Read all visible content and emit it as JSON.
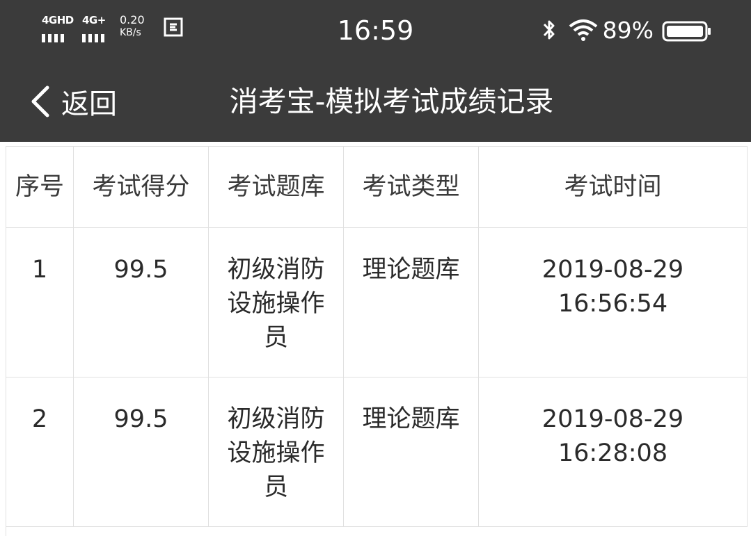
{
  "status": {
    "net1": "4GHD",
    "net2": "4G+",
    "speed_value": "0.20",
    "speed_unit": "KB/s",
    "time": "16:59",
    "battery": "89%"
  },
  "nav": {
    "back_label": "返回",
    "title": "消考宝-模拟考试成绩记录"
  },
  "table": {
    "headers": [
      "序号",
      "考试得分",
      "考试题库",
      "考试类型",
      "考试时间"
    ],
    "rows": [
      {
        "index": "1",
        "score": "99.5",
        "bank_line1": "初级消防",
        "bank_line2": "设施操作",
        "bank_line3": "员",
        "type": "理论题库",
        "date": "2019-08-29",
        "time": "16:56:54"
      },
      {
        "index": "2",
        "score": "99.5",
        "bank_line1": "初级消防",
        "bank_line2": "设施操作",
        "bank_line3": "员",
        "type": "理论题库",
        "date": "2019-08-29",
        "time": "16:28:08"
      }
    ]
  },
  "colors": {
    "header_bg": "#3b3b3b",
    "border": "#e0e0e0"
  }
}
